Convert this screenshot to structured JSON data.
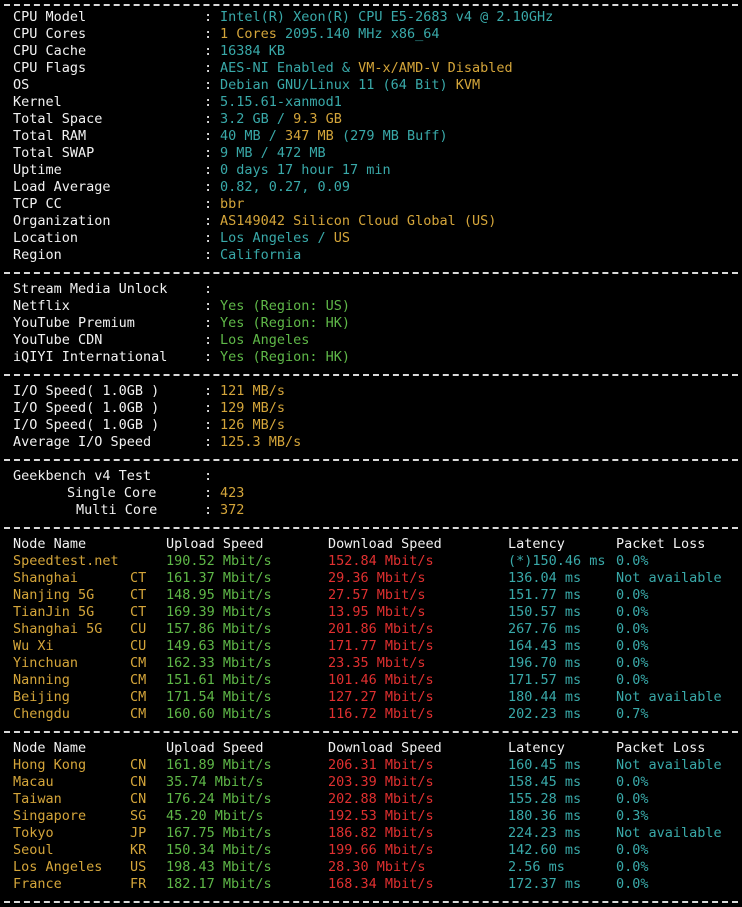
{
  "colors": {
    "background": "#000000",
    "label": "#f2f2f2",
    "cyan": "#39a9a9",
    "yellow": "#d4a53a",
    "green": "#5fb848",
    "red": "#e03030",
    "divider": "#d9d9d9"
  },
  "system_info": {
    "separator": ":",
    "items": [
      {
        "label": "CPU Model",
        "parts": [
          {
            "text": "Intel(R) Xeon(R) CPU E5-2683 v4 @ 2.10GHz",
            "color": "c"
          }
        ]
      },
      {
        "label": "CPU Cores",
        "parts": [
          {
            "text": "1 Cores ",
            "color": "y"
          },
          {
            "text": "2095.140 MHz x86_64",
            "color": "c"
          }
        ]
      },
      {
        "label": "CPU Cache",
        "parts": [
          {
            "text": "16384 KB",
            "color": "c"
          }
        ]
      },
      {
        "label": "CPU Flags",
        "parts": [
          {
            "text": "AES-NI Enabled & ",
            "color": "c"
          },
          {
            "text": "VM-x/AMD-V Disabled",
            "color": "y"
          }
        ]
      },
      {
        "label": "OS",
        "parts": [
          {
            "text": "Debian GNU/Linux 11 (64 Bit) ",
            "color": "c"
          },
          {
            "text": "KVM",
            "color": "y"
          }
        ]
      },
      {
        "label": "Kernel",
        "parts": [
          {
            "text": "5.15.61-xanmod1",
            "color": "c"
          }
        ]
      },
      {
        "label": "Total Space",
        "parts": [
          {
            "text": "3.2 GB / ",
            "color": "c"
          },
          {
            "text": "9.3 GB",
            "color": "y"
          }
        ]
      },
      {
        "label": "Total RAM",
        "parts": [
          {
            "text": "40 MB / ",
            "color": "c"
          },
          {
            "text": "347 MB",
            "color": "y"
          },
          {
            "text": " (279 MB Buff)",
            "color": "c"
          }
        ]
      },
      {
        "label": "Total SWAP",
        "parts": [
          {
            "text": "9 MB / 472 MB",
            "color": "c"
          }
        ]
      },
      {
        "label": "Uptime",
        "parts": [
          {
            "text": "0 days 17 hour 17 min",
            "color": "c"
          }
        ]
      },
      {
        "label": "Load Average",
        "parts": [
          {
            "text": "0.82, 0.27, 0.09",
            "color": "c"
          }
        ]
      },
      {
        "label": "TCP CC",
        "parts": [
          {
            "text": "bbr",
            "color": "y"
          }
        ]
      },
      {
        "label": "Organization",
        "parts": [
          {
            "text": "AS149042 Silicon Cloud Global (US)",
            "color": "y"
          }
        ]
      },
      {
        "label": "Location",
        "parts": [
          {
            "text": "Los Angeles / ",
            "color": "c"
          },
          {
            "text": "US",
            "color": "y"
          }
        ]
      },
      {
        "label": "Region",
        "parts": [
          {
            "text": "California",
            "color": "c"
          }
        ]
      }
    ]
  },
  "stream_media": {
    "header": "Stream Media Unlock",
    "items": [
      {
        "label": "Netflix",
        "value": "Yes (Region: US)",
        "color": "g"
      },
      {
        "label": "YouTube Premium",
        "value": "Yes (Region: HK)",
        "color": "g"
      },
      {
        "label": "YouTube CDN",
        "value": "Los Angeles",
        "color": "g"
      },
      {
        "label": "iQIYI International",
        "value": "Yes (Region: HK)",
        "color": "g"
      }
    ]
  },
  "io_speed": {
    "items": [
      {
        "label": "I/O Speed( 1.0GB )",
        "value": "121 MB/s"
      },
      {
        "label": "I/O Speed( 1.0GB )",
        "value": "129 MB/s"
      },
      {
        "label": "I/O Speed( 1.0GB )",
        "value": "126 MB/s"
      },
      {
        "label": "Average I/O Speed",
        "value": "125.3 MB/s"
      }
    ]
  },
  "geekbench": {
    "header": "Geekbench v4 Test",
    "items": [
      {
        "label": "Single Core",
        "value": "423"
      },
      {
        "label": "Multi Core",
        "value": "372"
      }
    ]
  },
  "speed_table_1": {
    "headers": {
      "node": "Node Name",
      "upload": "Upload Speed",
      "download": "Download Speed",
      "latency": "Latency",
      "loss": "Packet Loss"
    },
    "rows": [
      {
        "name": "Speedtest.net",
        "isp": "",
        "upload": "190.52 Mbit/s",
        "download": "152.84 Mbit/s",
        "latency": "(*)150.46 ms",
        "loss": "0.0%"
      },
      {
        "name": "Shanghai",
        "isp": "CT",
        "upload": "161.37 Mbit/s",
        "download": "29.36 Mbit/s",
        "latency": "136.04 ms",
        "loss": "Not available"
      },
      {
        "name": "Nanjing 5G",
        "isp": "CT",
        "upload": "148.95 Mbit/s",
        "download": "27.57 Mbit/s",
        "latency": "151.77 ms",
        "loss": "0.0%"
      },
      {
        "name": "TianJin 5G",
        "isp": "CT",
        "upload": "169.39 Mbit/s",
        "download": "13.95 Mbit/s",
        "latency": "150.57 ms",
        "loss": "0.0%"
      },
      {
        "name": "Shanghai 5G",
        "isp": "CU",
        "upload": "157.86 Mbit/s",
        "download": "201.86 Mbit/s",
        "latency": "267.76 ms",
        "loss": "0.0%"
      },
      {
        "name": "Wu Xi",
        "isp": "CU",
        "upload": "149.63 Mbit/s",
        "download": "171.77 Mbit/s",
        "latency": "164.43 ms",
        "loss": "0.0%"
      },
      {
        "name": "Yinchuan",
        "isp": "CM",
        "upload": "162.33 Mbit/s",
        "download": "23.35 Mbit/s",
        "latency": "196.70 ms",
        "loss": "0.0%"
      },
      {
        "name": "Nanning",
        "isp": "CM",
        "upload": "151.61 Mbit/s",
        "download": "101.46 Mbit/s",
        "latency": "171.57 ms",
        "loss": "0.0%"
      },
      {
        "name": "Beijing",
        "isp": "CM",
        "upload": "171.54 Mbit/s",
        "download": "127.27 Mbit/s",
        "latency": "180.44 ms",
        "loss": "Not available"
      },
      {
        "name": "Chengdu",
        "isp": "CM",
        "upload": "160.60 Mbit/s",
        "download": "116.72 Mbit/s",
        "latency": "202.23 ms",
        "loss": "0.7%"
      }
    ]
  },
  "speed_table_2": {
    "headers": {
      "node": "Node Name",
      "upload": "Upload Speed",
      "download": "Download Speed",
      "latency": "Latency",
      "loss": "Packet Loss"
    },
    "rows": [
      {
        "name": "Hong Kong",
        "isp": "CN",
        "upload": "161.89 Mbit/s",
        "download": "206.31 Mbit/s",
        "latency": "160.45 ms",
        "loss": "Not available"
      },
      {
        "name": "Macau",
        "isp": "CN",
        "upload": "35.74 Mbit/s",
        "download": "203.39 Mbit/s",
        "latency": "158.45 ms",
        "loss": "0.0%"
      },
      {
        "name": "Taiwan",
        "isp": "CN",
        "upload": "176.24 Mbit/s",
        "download": "202.88 Mbit/s",
        "latency": "155.28 ms",
        "loss": "0.0%"
      },
      {
        "name": "Singapore",
        "isp": "SG",
        "upload": "45.20 Mbit/s",
        "download": "192.53 Mbit/s",
        "latency": "180.36 ms",
        "loss": "0.3%"
      },
      {
        "name": "Tokyo",
        "isp": "JP",
        "upload": "167.75 Mbit/s",
        "download": "186.82 Mbit/s",
        "latency": "224.23 ms",
        "loss": "Not available"
      },
      {
        "name": "Seoul",
        "isp": "KR",
        "upload": "150.34 Mbit/s",
        "download": "199.66 Mbit/s",
        "latency": "142.60 ms",
        "loss": "0.0%"
      },
      {
        "name": "Los Angeles",
        "isp": "US",
        "upload": "198.43 Mbit/s",
        "download": "28.30 Mbit/s",
        "latency": "2.56 ms",
        "loss": "0.0%"
      },
      {
        "name": "France",
        "isp": "FR",
        "upload": "182.17 Mbit/s",
        "download": "168.34 Mbit/s",
        "latency": "172.37 ms",
        "loss": "0.0%"
      }
    ]
  }
}
